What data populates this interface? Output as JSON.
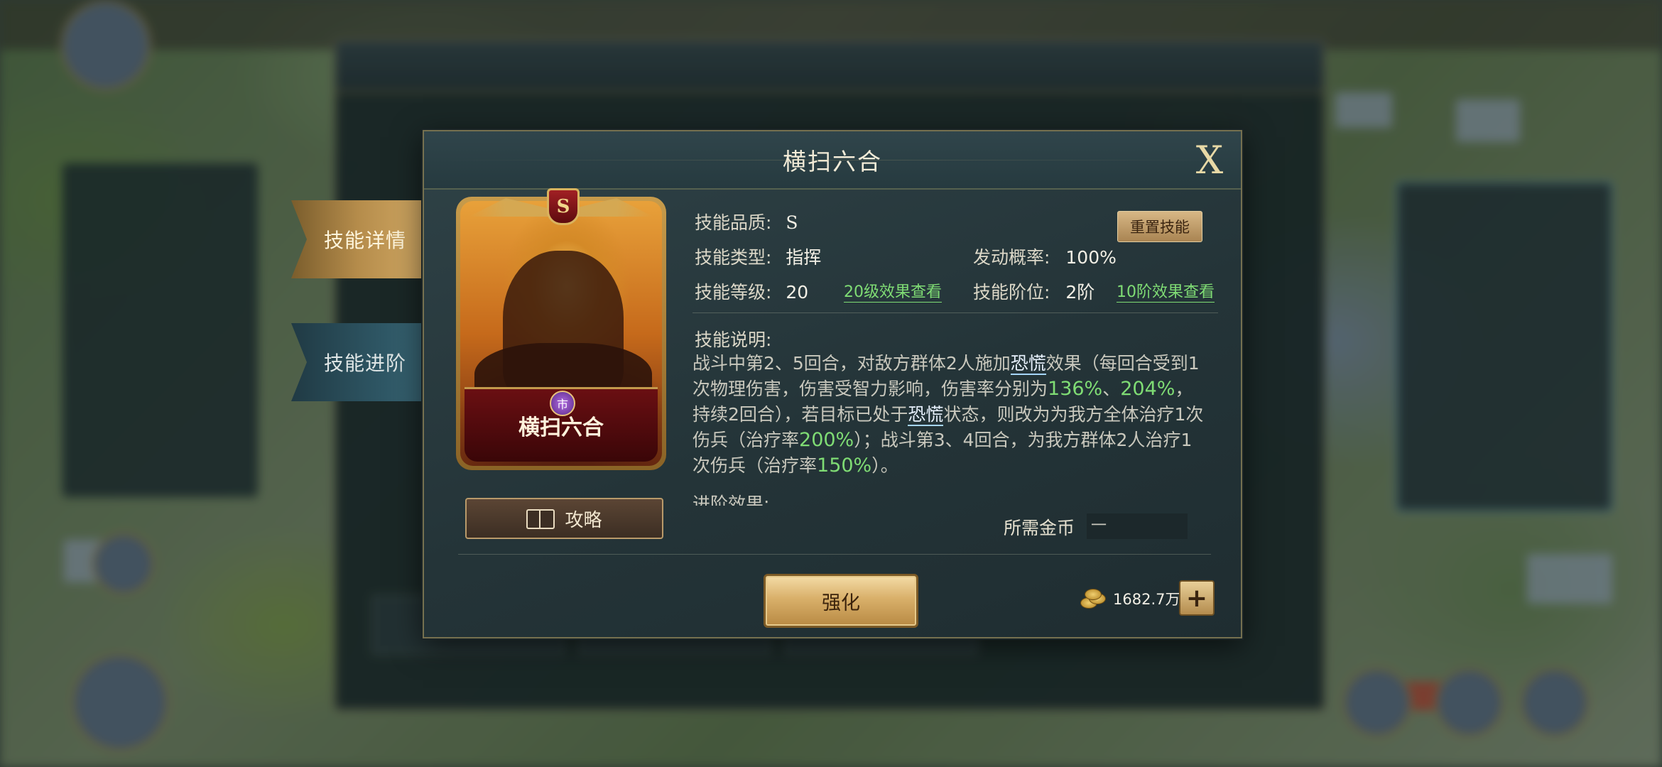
{
  "dialog": {
    "title": "横扫六合",
    "close_glyph": "X"
  },
  "tabs": [
    {
      "label": "技能详情",
      "active": true
    },
    {
      "label": "技能进阶",
      "active": false
    }
  ],
  "card": {
    "rank_glyph": "S",
    "name": "横扫六合",
    "gem_glyph": "市",
    "guide_label": "攻略"
  },
  "skill": {
    "quality_label": "技能品质:",
    "quality_value": "S",
    "type_label": "技能类型:",
    "type_value": "指挥",
    "trigger_label": "发动概率:",
    "trigger_value": "100%",
    "level_label": "技能等级:",
    "level_value": "20",
    "level_link": "20级效果查看",
    "tier_label": "技能阶位:",
    "tier_value": "2阶",
    "tier_link": "10阶效果查看",
    "reset_label": "重置技能",
    "desc_label": "技能说明:",
    "desc": {
      "p1": "战斗中第2、5回合，对敌方群体2人施加",
      "kw1": "恐慌",
      "p2": "效果（每回合受到1次物理伤害，伤害受智力影响，伤害率分别为",
      "v1": "136%",
      "p3": "、",
      "v2": "204%",
      "p4": "，持续2回合），若目标已处于",
      "kw2": "恐慌",
      "p5": "状态，则改为为我方全体治疗1次伤兵（治疗率",
      "v3": "200%",
      "p6": "）；战斗第3、4回合，为我方群体2人治疗1次伤兵（治疗率",
      "v4": "150%",
      "p7": "）。"
    },
    "advance_label_partial": "进阶效果:"
  },
  "cost": {
    "gold_label": "所需金币",
    "gold_value": "一",
    "coins": "1682.7万",
    "enhance_label": "强化",
    "plus_glyph": "+"
  },
  "colors": {
    "accent_green": "#7fdc74",
    "gold": "#d9b06a",
    "panel": "#263a3f"
  }
}
